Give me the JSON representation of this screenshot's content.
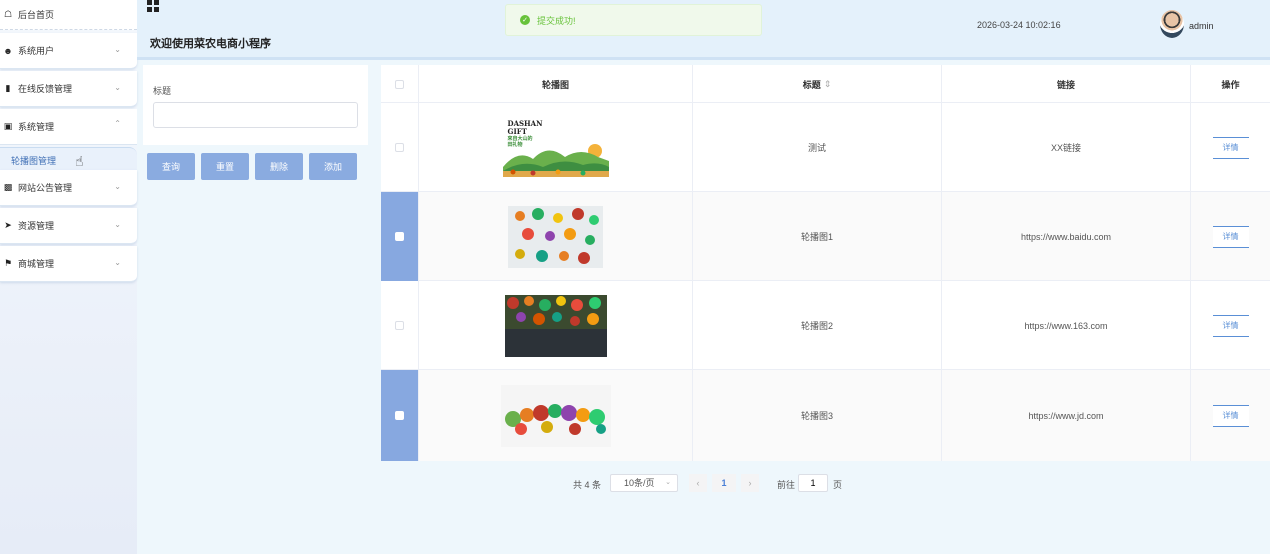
{
  "sidebar": {
    "items": [
      {
        "label": "后台首页",
        "icon": "home-icon"
      },
      {
        "label": "系统用户",
        "icon": "user-icon"
      },
      {
        "label": "在线反馈管理",
        "icon": "bar-chart-icon"
      },
      {
        "label": "系统管理",
        "icon": "chat-icon"
      },
      {
        "label": "网站公告管理",
        "icon": "monitor-icon"
      },
      {
        "label": "资源管理",
        "icon": "send-icon"
      },
      {
        "label": "商城管理",
        "icon": "flag-icon"
      }
    ],
    "sub_item": "轮播图管理"
  },
  "header": {
    "welcome": "欢迎使用菜农电商小程序",
    "toast": "提交成功!",
    "datetime": "2026-03-24 10:02:16",
    "user": "admin"
  },
  "search": {
    "label": "标题",
    "value": "",
    "buttons": {
      "query": "查询",
      "reset": "重置",
      "delete": "删除",
      "add": "添加"
    }
  },
  "table": {
    "columns": {
      "image": "轮播图",
      "title": "标题",
      "sort_icon": "⇕",
      "link": "链接",
      "action": "操作"
    },
    "rows": [
      {
        "title": "测试",
        "link": "XX链接",
        "selected": false,
        "thumb_text": [
          "DASHAN",
          "GIFT",
          "來自大山的",
          "田礼物"
        ]
      },
      {
        "title": "轮播图1",
        "link": "https://www.baidu.com",
        "selected": true
      },
      {
        "title": "轮播图2",
        "link": "https://www.163.com",
        "selected": false
      },
      {
        "title": "轮播图3",
        "link": "https://www.jd.com",
        "selected": true
      }
    ],
    "detail_label": "详情"
  },
  "pagination": {
    "total": "共 4 条",
    "page_size": "10条/页",
    "current_page": "1",
    "goto_label": "前往",
    "goto_value": "1",
    "unit": "页"
  },
  "colors": {
    "accent": "#8aabe0",
    "selected_row": "#87a8e0",
    "toast_green": "#67c23a"
  }
}
